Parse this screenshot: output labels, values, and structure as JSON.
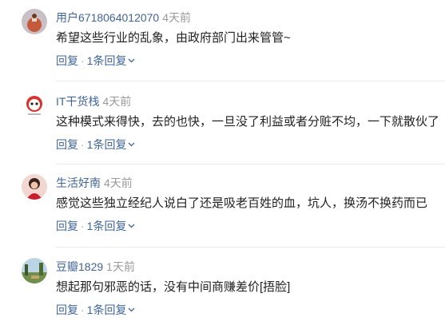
{
  "comments": [
    {
      "username": "用户6718064012070",
      "time": "4天前",
      "content": "希望这些行业的乱象，由政府部门出来管管~",
      "reply_label": "回复",
      "separator": "·",
      "replies_label": "1条回复",
      "avatar": "avatar-1"
    },
    {
      "username": "IT干货栈",
      "time": "4天前",
      "content": "这种模式来得快，去的也快，一旦没了利益或者分赃不均，一下就散伙了",
      "reply_label": "回复",
      "separator": "·",
      "replies_label": "1条回复",
      "avatar": "avatar-2"
    },
    {
      "username": "生活好南",
      "time": "4天前",
      "content": "感觉这些独立经纪人说白了还是吸老百姓的血，坑人，换汤不换药而已",
      "reply_label": "回复",
      "separator": "·",
      "replies_label": "1条回复",
      "avatar": "avatar-3"
    },
    {
      "username": "豆瓣1829",
      "time": "1天前",
      "content": "想起那句邪恶的话，没有中间商赚差价[捂脸]",
      "reply_label": "回复",
      "separator": "·",
      "replies_label": "1条回复",
      "avatar": "avatar-4"
    }
  ],
  "colors": {
    "username": "#406599",
    "time": "#999999",
    "content": "#222222",
    "divider": "#ececec"
  },
  "icons": {
    "expand_replies": "chevron-down-icon"
  }
}
